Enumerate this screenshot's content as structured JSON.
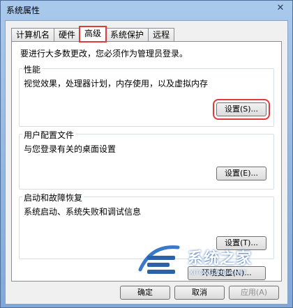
{
  "window": {
    "title": "系统属性",
    "close_glyph": "✕"
  },
  "tabs": [
    {
      "label": "计算机名"
    },
    {
      "label": "硬件"
    },
    {
      "label": "高级",
      "active": true
    },
    {
      "label": "系统保护"
    },
    {
      "label": "远程"
    }
  ],
  "notice": "要进行大多数更改，您必须作为管理员登录。",
  "groups": {
    "performance": {
      "title": "性能",
      "desc": "视觉效果，处理器计划，内存使用，以及虚拟内存",
      "button": "设置(S)..."
    },
    "profiles": {
      "title": "用户配置文件",
      "desc": "与您登录有关的桌面设置",
      "button": "设置(E)..."
    },
    "startup": {
      "title": "启动和故障恢复",
      "desc": "系统启动、系统失败和调试信息",
      "button": "设置(T)..."
    }
  },
  "env_button": "环境变量(N)...",
  "footer": {
    "ok": "确定",
    "cancel": "取消",
    "apply": "应用(A)"
  },
  "watermark": {
    "title": "系统之家",
    "sub": "XITONGZHIJIA.NET"
  },
  "colors": {
    "highlight": "#e03b3b",
    "titlebar": "#a9c9ec"
  }
}
